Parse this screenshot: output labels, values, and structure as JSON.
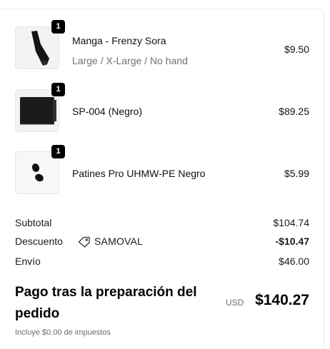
{
  "items": [
    {
      "quantity": "1",
      "name": "Manga - Frenzy Sora",
      "variant": "Large / X-Large / No hand",
      "price": "$9.50",
      "image_icon": "sleeve-icon"
    },
    {
      "quantity": "1",
      "name": "SP-004 (Negro)",
      "price": "$89.25",
      "image_icon": "pad-icon"
    },
    {
      "quantity": "1",
      "name": "Patines Pro UHMW-PE Negro",
      "price": "$5.99",
      "image_icon": "skates-icon"
    }
  ],
  "summary": {
    "subtotal_label": "Subtotal",
    "subtotal_value": "$104.74",
    "discount_label": "Descuento",
    "discount_icon": "tag-icon",
    "discount_code": "SAMOVAL",
    "discount_value": "-$10.47",
    "shipping_label": "Envío",
    "shipping_value": "$46.00"
  },
  "total": {
    "label": "Pago tras la preparación del pedido",
    "currency": "USD",
    "amount": "$140.27",
    "taxes_note": "Incluye $0.00 de impuestos"
  }
}
